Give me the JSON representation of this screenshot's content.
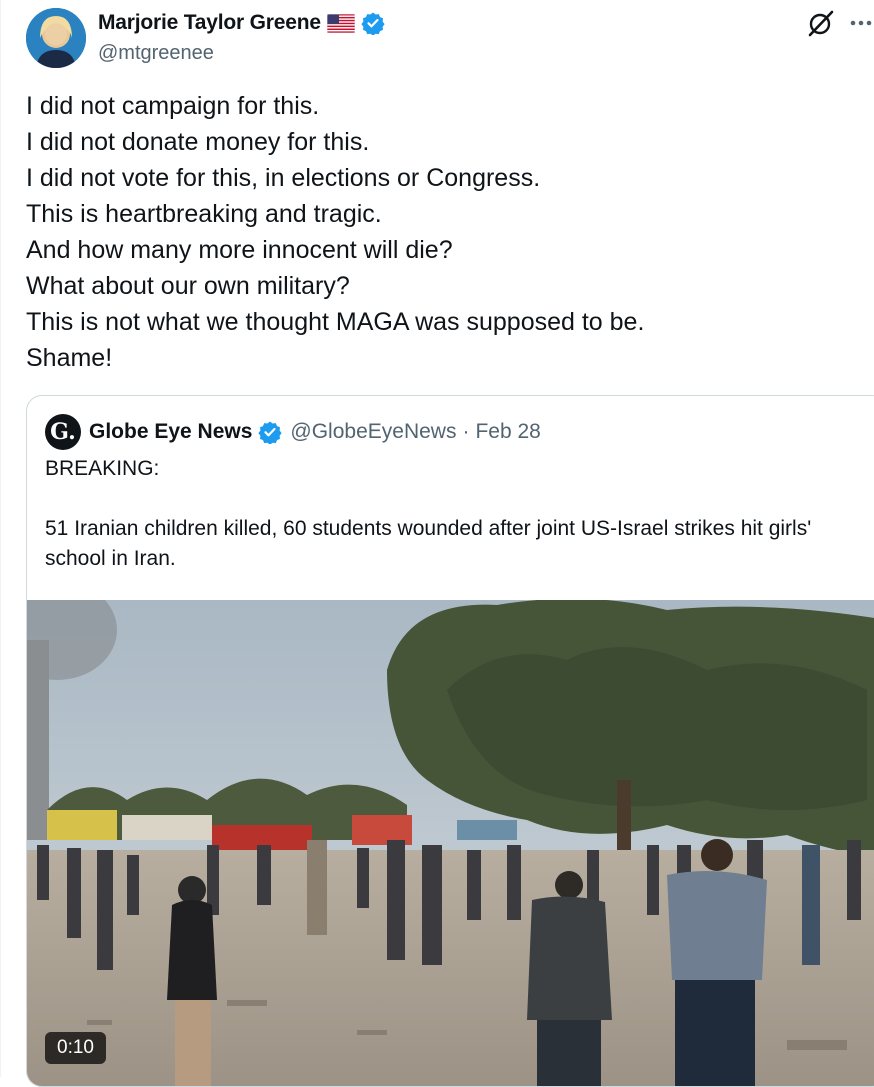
{
  "author": {
    "display_name": "Marjorie Taylor Greene",
    "handle": "@mtgreenee",
    "flag_icon": "us-flag-emoji",
    "verified_icon": "verified-badge-icon"
  },
  "actions": {
    "grok_icon": "grok-icon",
    "more_icon": "more-icon"
  },
  "tweet": {
    "text": "I did not campaign for this.\nI did not donate money for this.\nI did not vote for this, in elections or Congress.\nThis is heartbreaking and tragic.\nAnd how many more innocent will die?\nWhat about our own military?\nThis is not what we thought MAGA was supposed to be.\nShame!"
  },
  "quote": {
    "avatar_letter": "G.",
    "display_name": "Globe Eye News",
    "handle": "@GlobeEyeNews",
    "separator": "·",
    "date": "Feb 28",
    "text": "BREAKING:\n\n51 Iranian children killed, 60 students wounded after joint US-Israel strikes hit girls' school in Iran.",
    "video_duration": "0:10"
  },
  "colors": {
    "accent": "#1d9bf0",
    "text_primary": "#0f1419",
    "text_secondary": "#536471",
    "border": "#cfd9de"
  }
}
